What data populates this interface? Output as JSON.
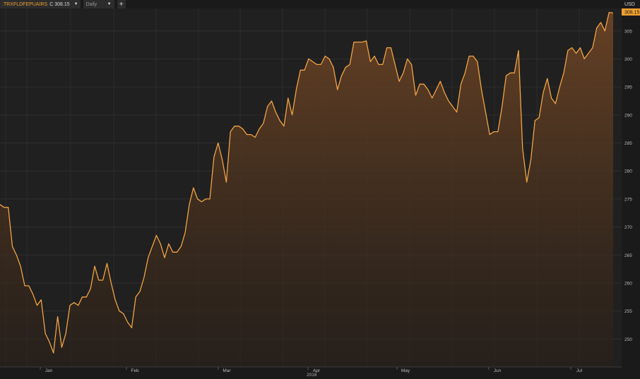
{
  "toolbar": {
    "symbol": ".TRXFLDFEPUAIRS",
    "close_label": "C",
    "last_price": "308.15",
    "period": "Daily",
    "add_label": "+"
  },
  "colors": {
    "background": "#1a1a1a",
    "plot_background": "#222222",
    "line": "#f2a345",
    "fill_top": "#6a4325",
    "price_tag": "#f0a030"
  },
  "chart_data": {
    "type": "area",
    "title": "",
    "xlabel": "",
    "ylabel": "",
    "currency_label": "USD",
    "last_value_label": "308.15",
    "year_label": "2016",
    "month_labels": [
      "Jan",
      "Feb",
      "Mar",
      "Apr",
      "May",
      "Jun",
      "Jul"
    ],
    "ylim": [
      245,
      309
    ],
    "y_ticks": [
      250,
      255,
      260,
      265,
      270,
      275,
      280,
      285,
      290,
      295,
      300,
      305
    ],
    "grid": true,
    "series": [
      {
        "values": [
          274,
          273.5,
          273.5,
          266.5,
          265,
          263,
          259.5,
          259.5,
          258,
          256,
          257,
          251,
          249.5,
          247.5,
          254,
          248.5,
          251,
          256,
          256.5,
          256,
          257.5,
          257.5,
          259,
          263,
          260.5,
          260.5,
          263.5,
          260,
          257,
          255,
          254.5,
          253,
          252,
          257.5,
          258.5,
          261,
          264.5,
          266.5,
          268.5,
          267,
          264.5,
          267,
          265.5,
          265.5,
          266.5,
          269,
          274,
          277,
          275,
          274.5,
          275,
          275,
          282.5,
          285,
          282,
          278,
          287,
          288,
          288,
          287.5,
          286.5,
          286.5,
          286,
          287.5,
          288.5,
          291.5,
          292.5,
          290.5,
          289,
          288,
          293,
          290,
          294.5,
          298,
          298,
          300,
          299.5,
          299,
          299,
          300.5,
          300,
          298.5,
          294.5,
          297,
          298.5,
          299,
          303,
          303,
          303,
          303.2,
          299.5,
          300.5,
          299,
          299,
          302,
          302,
          299,
          296,
          297.5,
          300,
          299,
          293.5,
          295.5,
          295.5,
          294.5,
          293,
          294.5,
          296,
          294,
          292.5,
          291.5,
          290.5,
          295.5,
          297.5,
          300.5,
          300.5,
          299.5,
          294.5,
          290.5,
          286.5,
          287,
          287,
          291.5,
          297,
          297.5,
          297.5,
          301.5,
          284,
          278,
          282,
          289,
          289.5,
          294,
          296.5,
          293,
          292,
          295,
          297.5,
          301.5,
          302,
          301,
          302,
          300,
          301,
          302,
          305.5,
          306.5,
          305,
          308.3,
          308.2
        ]
      }
    ]
  }
}
